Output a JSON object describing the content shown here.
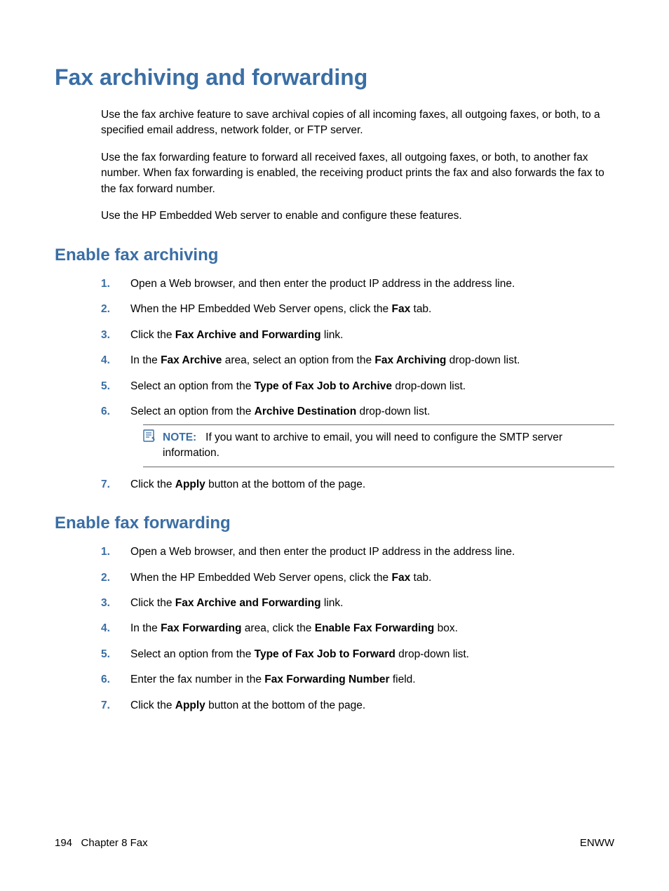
{
  "title": "Fax archiving and forwarding",
  "intro": {
    "p1": "Use the fax archive feature to save archival copies of all incoming faxes, all outgoing faxes, or both, to a specified email address, network folder, or FTP server.",
    "p2": "Use the fax forwarding feature to forward all received faxes, all outgoing faxes, or both, to another fax number. When fax forwarding is enabled, the receiving product prints the fax and also forwards the fax to the fax forward number.",
    "p3": "Use the HP Embedded Web server to enable and configure these features."
  },
  "section1": {
    "heading": "Enable fax archiving",
    "steps": {
      "s1": "Open a Web browser, and then enter the product IP address in the address line.",
      "s2_a": "When the HP Embedded Web Server opens, click the ",
      "s2_b": "Fax",
      "s2_c": " tab.",
      "s3_a": "Click the ",
      "s3_b": "Fax Archive and Forwarding",
      "s3_c": " link.",
      "s4_a": "In the ",
      "s4_b": "Fax Archive",
      "s4_c": " area, select an option from the ",
      "s4_d": "Fax Archiving",
      "s4_e": " drop-down list.",
      "s5_a": "Select an option from the ",
      "s5_b": "Type of Fax Job to Archive",
      "s5_c": " drop-down list.",
      "s6_a": "Select an option from the ",
      "s6_b": "Archive Destination",
      "s6_c": " drop-down list.",
      "note_label": "NOTE:",
      "note_text": "If you want to archive to email, you will need to configure the SMTP server information.",
      "s7_a": "Click the ",
      "s7_b": "Apply",
      "s7_c": " button at the bottom of the page."
    }
  },
  "section2": {
    "heading": "Enable fax forwarding",
    "steps": {
      "s1": "Open a Web browser, and then enter the product IP address in the address line.",
      "s2_a": "When the HP Embedded Web Server opens, click the ",
      "s2_b": "Fax",
      "s2_c": " tab.",
      "s3_a": "Click the ",
      "s3_b": "Fax Archive and Forwarding",
      "s3_c": " link.",
      "s4_a": "In the ",
      "s4_b": "Fax Forwarding",
      "s4_c": " area, click the ",
      "s4_d": "Enable Fax Forwarding",
      "s4_e": " box.",
      "s5_a": "Select an option from the ",
      "s5_b": "Type of Fax Job to Forward",
      "s5_c": " drop-down list.",
      "s6_a": "Enter the fax number in the ",
      "s6_b": "Fax Forwarding Number",
      "s6_c": " field.",
      "s7_a": "Click the ",
      "s7_b": "Apply",
      "s7_c": " button at the bottom of the page."
    }
  },
  "footer": {
    "page_num": "194",
    "chapter": "Chapter 8   Fax",
    "right": "ENWW"
  },
  "numbers": {
    "n1": "1.",
    "n2": "2.",
    "n3": "3.",
    "n4": "4.",
    "n5": "5.",
    "n6": "6.",
    "n7": "7."
  }
}
